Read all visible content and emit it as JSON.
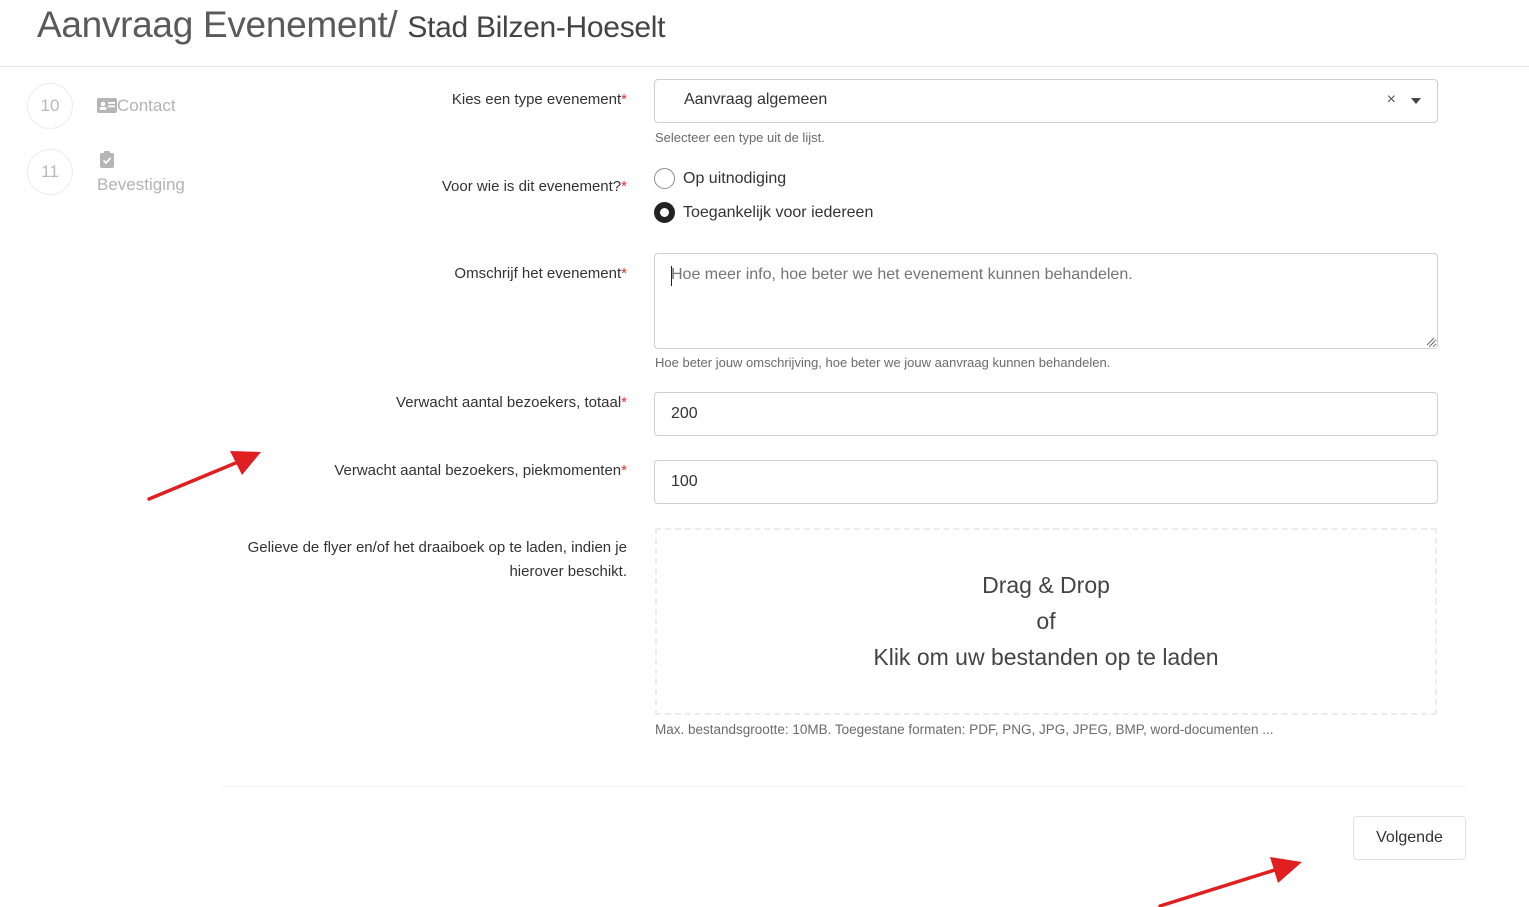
{
  "header": {
    "title": "Aanvraag Evenement/",
    "subtitle": "Stad Bilzen-Hoeselt"
  },
  "steps": [
    {
      "number": "10",
      "label": "Contact",
      "icon": "id-card-icon"
    },
    {
      "number": "11",
      "label": "Bevestiging",
      "icon": "clipboard-check-icon"
    }
  ],
  "form": {
    "type": {
      "label": "Kies een type evenement",
      "required_mark": "*",
      "value": "Aanvraag algemeen",
      "clear_symbol": "×",
      "help": "Selecteer een type uit de lijst."
    },
    "audience": {
      "label": "Voor wie is dit evenement?",
      "required_mark": "*",
      "options": [
        {
          "label": "Op uitnodiging",
          "checked": false
        },
        {
          "label": "Toegankelijk voor iedereen",
          "checked": true
        }
      ]
    },
    "description": {
      "label": "Omschrijf het evenement",
      "required_mark": "*",
      "placeholder": "Hoe meer info, hoe beter we het evenement kunnen behandelen.",
      "help": "Hoe beter jouw omschrijving, hoe beter we jouw aanvraag kunnen behandelen."
    },
    "visitors_total": {
      "label": "Verwacht aantal bezoekers, totaal",
      "required_mark": "*",
      "value": "200"
    },
    "visitors_peak": {
      "label": "Verwacht aantal bezoekers, piekmomenten",
      "required_mark": "*",
      "value": "100"
    },
    "upload": {
      "label": "Gelieve de flyer en/of het draaiboek op te laden, indien je hierover beschikt.",
      "line1": "Drag & Drop",
      "line2": "of",
      "line3": "Klik om uw bestanden op te laden",
      "help": "Max. bestandsgrootte: 10MB. Toegestane formaten: PDF, PNG, JPG, JPEG, BMP, word-documenten ..."
    }
  },
  "actions": {
    "next_label": "Volgende"
  },
  "colors": {
    "required": "#e03131",
    "annotation_arrow": "#e02020"
  }
}
